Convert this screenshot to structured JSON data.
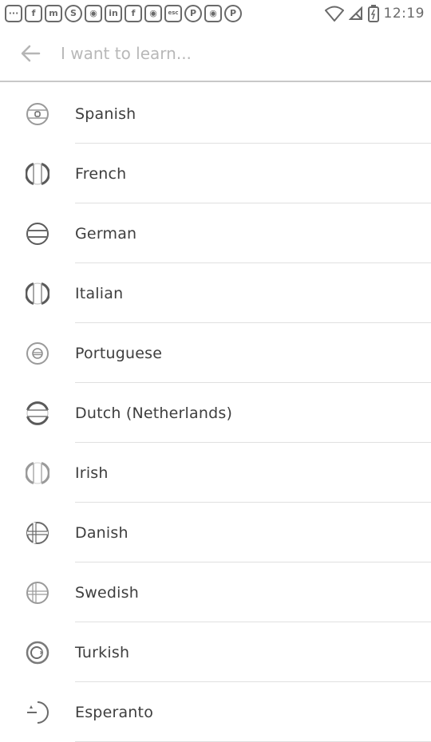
{
  "status_bar": {
    "notifications": [
      {
        "icon": "chat-bubble-icon",
        "glyph": "···"
      },
      {
        "icon": "facebook-icon",
        "glyph": "f"
      },
      {
        "icon": "messenger-icon",
        "glyph": "m"
      },
      {
        "icon": "skype-icon",
        "glyph": "S"
      },
      {
        "icon": "game-icon",
        "glyph": "◉"
      },
      {
        "icon": "linkedin-icon",
        "glyph": "in"
      },
      {
        "icon": "facebook-icon",
        "glyph": "f"
      },
      {
        "icon": "game-icon",
        "glyph": "◉"
      },
      {
        "icon": "esc-icon",
        "glyph": "esc"
      },
      {
        "icon": "pinterest-icon",
        "glyph": "P"
      },
      {
        "icon": "game-icon",
        "glyph": "◉"
      },
      {
        "icon": "pinterest-icon",
        "glyph": "P"
      }
    ],
    "time": "12:19"
  },
  "app_bar": {
    "back_icon": "arrow-left-icon",
    "search_placeholder": "I want to learn..."
  },
  "languages": [
    {
      "name": "Spanish",
      "flag": "spain-flag-icon"
    },
    {
      "name": "French",
      "flag": "france-flag-icon"
    },
    {
      "name": "German",
      "flag": "germany-flag-icon"
    },
    {
      "name": "Italian",
      "flag": "italy-flag-icon"
    },
    {
      "name": "Portuguese",
      "flag": "portugal-flag-icon"
    },
    {
      "name": "Dutch (Netherlands)",
      "flag": "netherlands-flag-icon"
    },
    {
      "name": "Irish",
      "flag": "ireland-flag-icon"
    },
    {
      "name": "Danish",
      "flag": "denmark-flag-icon"
    },
    {
      "name": "Swedish",
      "flag": "sweden-flag-icon"
    },
    {
      "name": "Turkish",
      "flag": "turkey-flag-icon"
    },
    {
      "name": "Esperanto",
      "flag": "esperanto-flag-icon"
    }
  ]
}
